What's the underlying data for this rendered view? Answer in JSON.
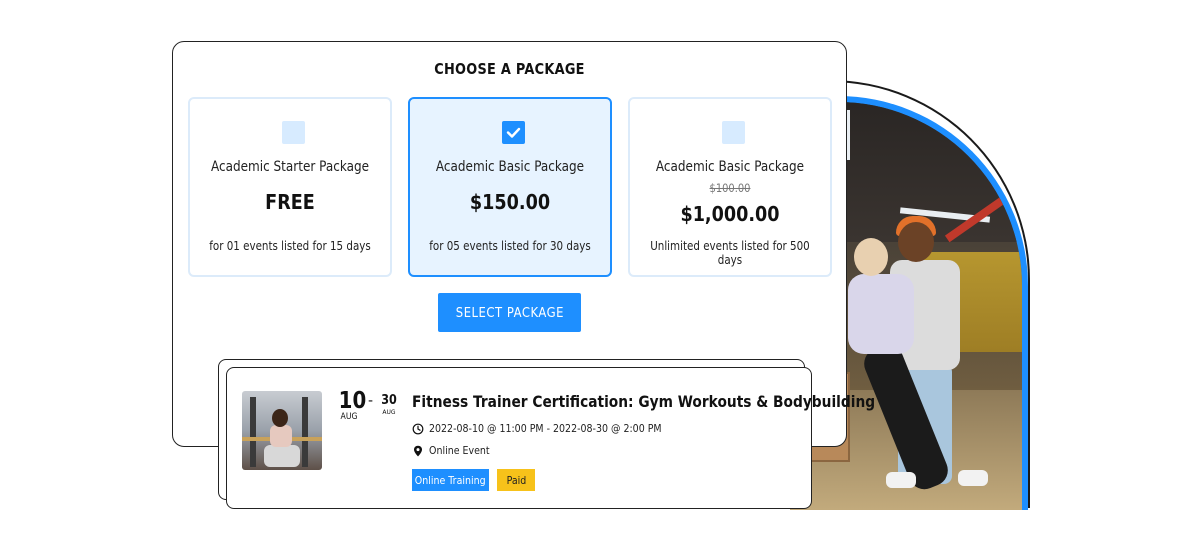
{
  "package_selector": {
    "title": "CHOOSE A PACKAGE",
    "packages": [
      {
        "name": "Academic Starter Package",
        "old_price": "",
        "price": "FREE",
        "description": "for 01 events listed for 15 days",
        "selected": false
      },
      {
        "name": "Academic Basic Package",
        "old_price": "",
        "price": "$150.00",
        "description": "for 05 events listed for 30 days",
        "selected": true
      },
      {
        "name": "Academic Basic Package",
        "old_price": "$100.00",
        "price": "$1,000.00",
        "description": "Unlimited events listed for 500 days",
        "selected": false
      }
    ],
    "select_button_label": "SELECT PACKAGE"
  },
  "event": {
    "start_day": "10",
    "start_month": "AUG",
    "date_separator": "-",
    "end_day": "30",
    "end_month": "AUG",
    "title": "Fitness Trainer Certification: Gym Workouts & Bodybuilding",
    "datetime": "2022-08-10 @ 11:00 PM - 2022-08-30 @ 2:00 PM",
    "location": "Online Event",
    "tags": [
      "Online Training",
      "Paid"
    ]
  },
  "colors": {
    "accent": "#1e8fff",
    "selected_bg": "#e7f3ff",
    "paid_tag": "#f7c21a"
  },
  "icons": {
    "checkbox_checked": "check-icon",
    "time": "clock-icon",
    "location": "map-pin-icon"
  }
}
